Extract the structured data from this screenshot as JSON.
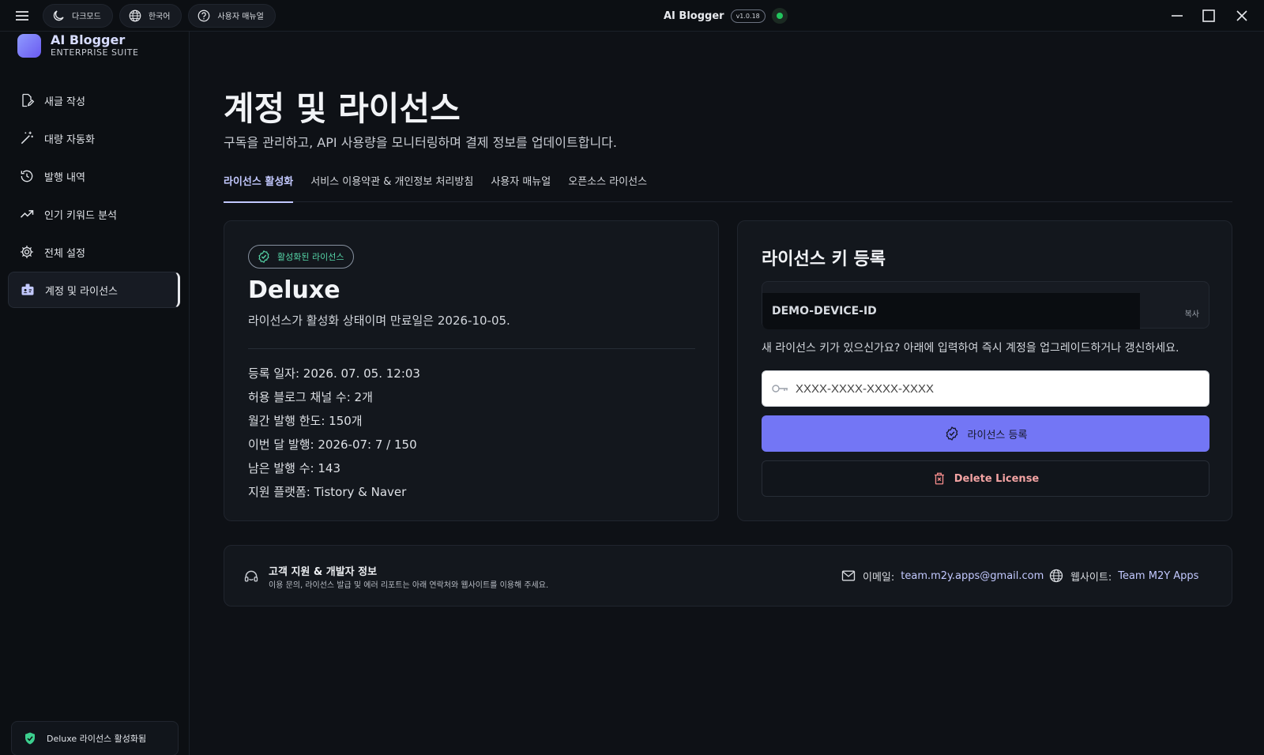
{
  "titlebar": {
    "dark_mode_label": "다크모드",
    "language_label": "한국어",
    "manual_label": "사용자 매뉴얼",
    "app_name": "AI Blogger",
    "version": "v1.0.18",
    "status_color": "#22c55e"
  },
  "brand": {
    "name": "AI Blogger",
    "subtitle": "ENTERPRISE SUITE"
  },
  "sidebar": {
    "items": [
      {
        "label": "새글 작성",
        "icon": "new-post-icon"
      },
      {
        "label": "대량 자동화",
        "icon": "magic-wand-icon"
      },
      {
        "label": "발행 내역",
        "icon": "history-icon"
      },
      {
        "label": "인기 키워드 분석",
        "icon": "trending-icon"
      },
      {
        "label": "전체 설정",
        "icon": "gear-icon"
      },
      {
        "label": "계정 및 라이선스",
        "icon": "id-card-icon"
      }
    ],
    "footer_label": "Deluxe 라이선스 활성화됨"
  },
  "page": {
    "title": "계정 및 라이선스",
    "subtitle": "구독을 관리하고, API 사용량을 모니터링하며 결제 정보를 업데이트합니다."
  },
  "tabs": [
    {
      "label": "라이선스 활성화"
    },
    {
      "label": "서비스 이용약관 & 개인정보 처리방침"
    },
    {
      "label": "사용자 매뉴얼"
    },
    {
      "label": "오픈소스 라이선스"
    }
  ],
  "license": {
    "badge": "활성화된 라이선스",
    "plan": "Deluxe",
    "status_text": "라이선스가 활성화 상태이며 만료일은 2026-10-05.",
    "details": [
      "등록 일자: 2026. 07. 05. 12:03",
      "허용 블로그 채널 수: 2개",
      "월간 발행 한도: 150개",
      "이번 달 발행: 2026-07: 7 / 150",
      "남은 발행 수: 143",
      "지원 플랫폼: Tistory & Naver"
    ]
  },
  "register": {
    "title": "라이선스 키 등록",
    "device_id": "DEMO-DEVICE-ID",
    "copy_label": "복사",
    "hint": "새 라이선스 키가 있으신가요? 아래에 입력하여 즉시 계정을 업그레이드하거나 갱신하세요.",
    "key_placeholder": "XXXX-XXXX-XXXX-XXXX",
    "register_label": "라이선스 등록",
    "delete_label": "Delete License"
  },
  "support": {
    "title": "고객 지원 & 개발자 정보",
    "description": "이용 문의, 라이선스 발급 및 에러 리포트는 아래 연락처와 웹사이트를 이용해 주세요.",
    "email_label": "이메일:",
    "email": "team.m2y.apps@gmail.com",
    "website_label": "웹사이트:",
    "website": "Team M2Y Apps"
  },
  "colors": {
    "accent": "#7376f5",
    "success": "#56d6a8",
    "danger": "#f3a3a3"
  }
}
